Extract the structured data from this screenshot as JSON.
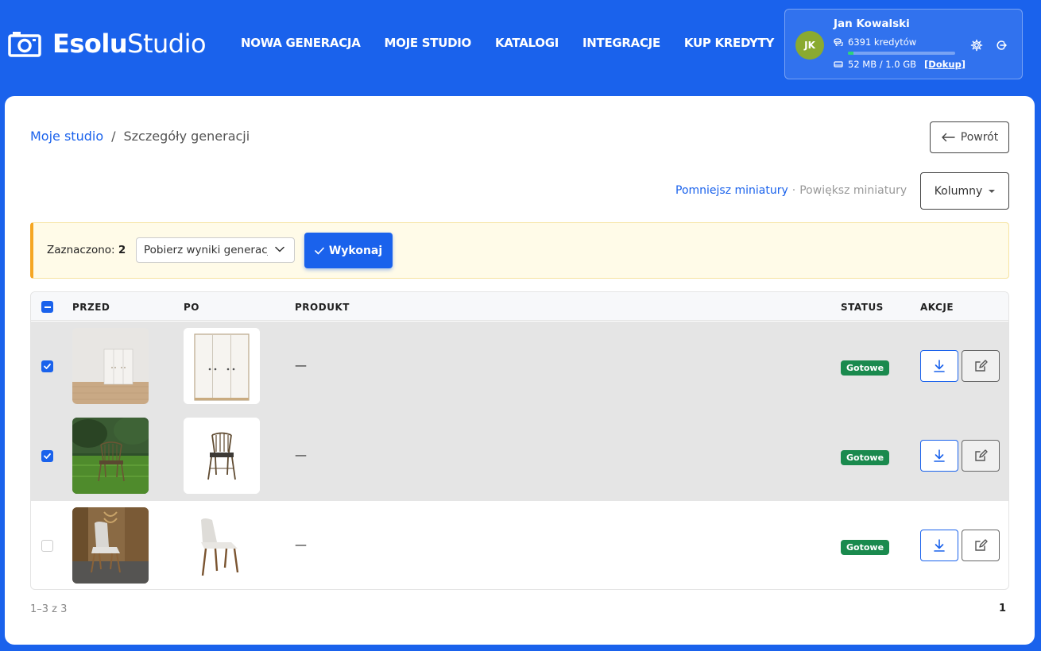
{
  "brand": {
    "bold": "Esolu",
    "light": "Studio"
  },
  "nav": [
    {
      "label": "NOWA GENERACJA"
    },
    {
      "label": "MOJE STUDIO"
    },
    {
      "label": "KATALOGI"
    },
    {
      "label": "INTEGRACJE"
    },
    {
      "label": "KUP KREDYTY"
    }
  ],
  "user": {
    "initials": "JK",
    "name": "Jan Kowalski",
    "credits": "6391 kredytów",
    "storage": "52 MB / 1.0 GB",
    "storage_link": "[Dokup]",
    "storage_fraction": 0.05
  },
  "breadcrumb": {
    "root": "Moje studio",
    "separator": "/",
    "current": "Szczegóły generacji"
  },
  "back_label": "Powrót",
  "thumbs": {
    "shrink": "Pomniejsz miniatury",
    "dot": "·",
    "enlarge": "Powiększ miniatury"
  },
  "columns_label": "Kolumny",
  "selection": {
    "label": "Zaznaczono:",
    "count": "2",
    "action": "Pobierz wyniki generacji",
    "run_label": "Wykonaj"
  },
  "table": {
    "headers": {
      "before": "PRZED",
      "after": "PO",
      "product": "PRODUKT",
      "status": "STATUS",
      "actions": "AKCJE"
    },
    "rows": [
      {
        "selected": true,
        "product": "—",
        "status": "Gotowe",
        "before": "wardrobe-room-photo",
        "after": "wardrobe-product-photo"
      },
      {
        "selected": true,
        "product": "—",
        "status": "Gotowe",
        "before": "chair-garden-photo",
        "after": "chair-product-photo"
      },
      {
        "selected": false,
        "product": "—",
        "status": "Gotowe",
        "before": "grey-chair-room-photo",
        "after": "grey-chair-product-photo"
      }
    ]
  },
  "pagination": {
    "range": "1–3 z 3",
    "page": "1"
  },
  "colors": {
    "brand": "#1a62ec",
    "success": "#1a8a4e",
    "warning": "#f5a623"
  }
}
